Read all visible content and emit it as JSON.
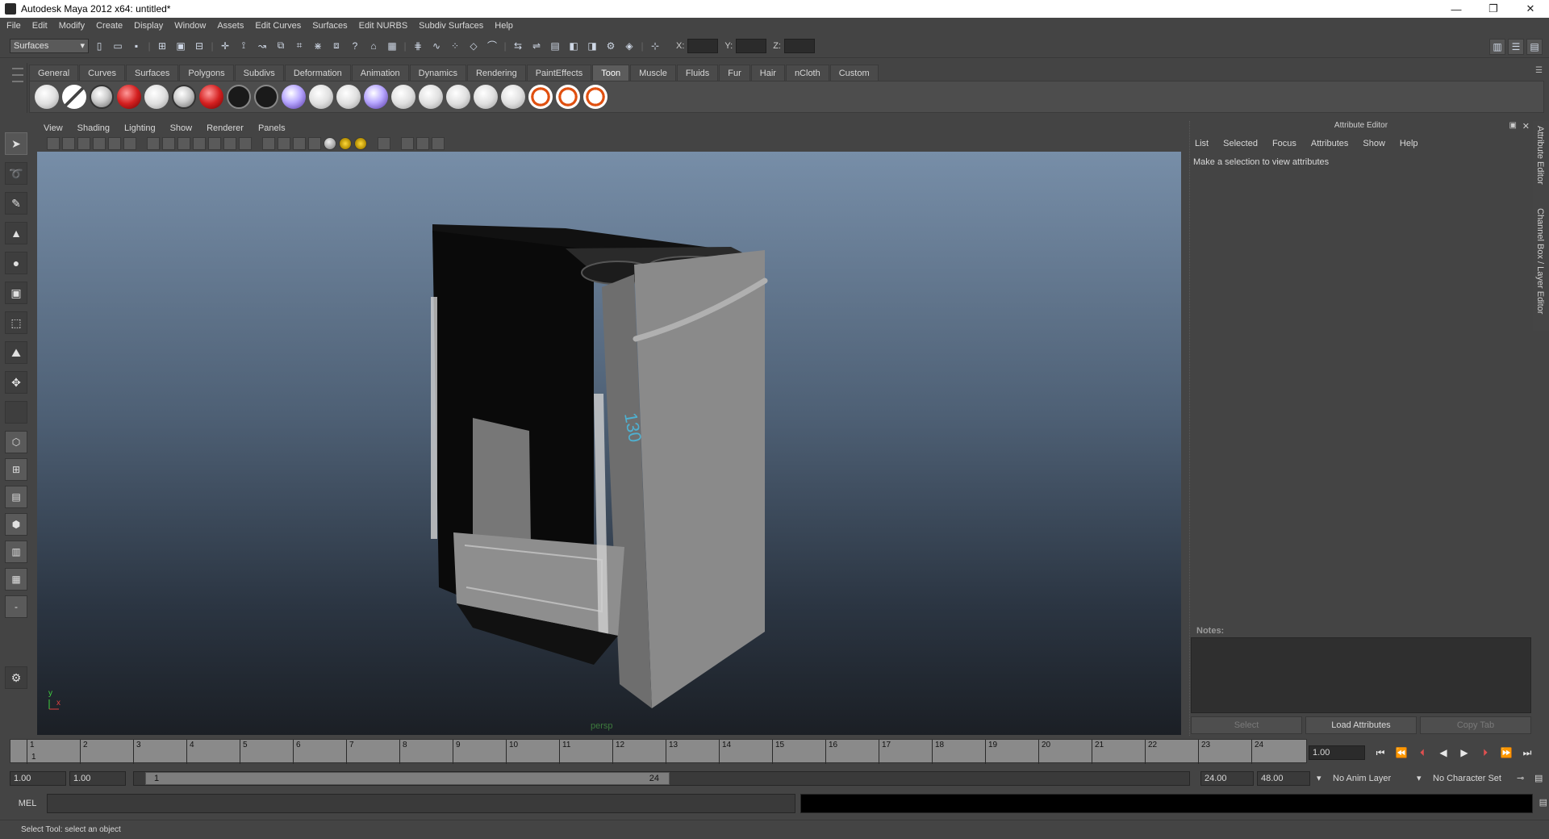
{
  "window": {
    "title": "Autodesk Maya 2012 x64: untitled*",
    "controls": [
      "—",
      "❐",
      "✕"
    ]
  },
  "menubar": [
    "File",
    "Edit",
    "Modify",
    "Create",
    "Display",
    "Window",
    "Assets",
    "Edit Curves",
    "Surfaces",
    "Edit NURBS",
    "Subdiv Surfaces",
    "Help"
  ],
  "statusline": {
    "mode": "Surfaces",
    "x_label": "X:",
    "y_label": "Y:",
    "z_label": "Z:"
  },
  "shelf": {
    "tabs": [
      "General",
      "Curves",
      "Surfaces",
      "Polygons",
      "Subdivs",
      "Deformation",
      "Animation",
      "Dynamics",
      "Rendering",
      "PaintEffects",
      "Toon",
      "Muscle",
      "Fluids",
      "Fur",
      "Hair",
      "nCloth",
      "Custom"
    ],
    "active_tab": "Toon"
  },
  "panel": {
    "menu": [
      "View",
      "Shading",
      "Lighting",
      "Show",
      "Renderer",
      "Panels"
    ],
    "camera_label": "persp",
    "axis_y": "y",
    "axis_x": "x"
  },
  "attribute_editor": {
    "title": "Attribute Editor",
    "menu": [
      "List",
      "Selected",
      "Focus",
      "Attributes",
      "Show",
      "Help"
    ],
    "message": "Make a selection to view attributes",
    "notes_label": "Notes:",
    "buttons": {
      "select": "Select",
      "load": "Load Attributes",
      "copy": "Copy Tab"
    }
  },
  "side_tabs": {
    "attribute": "Attribute Editor",
    "channel": "Channel Box / Layer Editor"
  },
  "timeline": {
    "ticks": [
      "1",
      "2",
      "3",
      "4",
      "5",
      "6",
      "7",
      "8",
      "9",
      "10",
      "11",
      "12",
      "13",
      "14",
      "15",
      "16",
      "17",
      "18",
      "19",
      "20",
      "21",
      "22",
      "23",
      "24"
    ],
    "current_frame_marker": "1",
    "current_time": "1.00"
  },
  "range": {
    "start": "1.00",
    "playback_start": "1.00",
    "range_start_label": "1",
    "range_end_label": "24",
    "playback_end": "24.00",
    "end": "48.00",
    "anim_layer": "No Anim Layer",
    "character_set": "No Character Set"
  },
  "command_line": {
    "label": "MEL"
  },
  "help_line": "Select Tool: select an object",
  "colors": {
    "viewport_top": "#778ea8",
    "viewport_bottom": "#1b1f25",
    "ui_bg": "#444444",
    "accent_red": "#d42020"
  }
}
